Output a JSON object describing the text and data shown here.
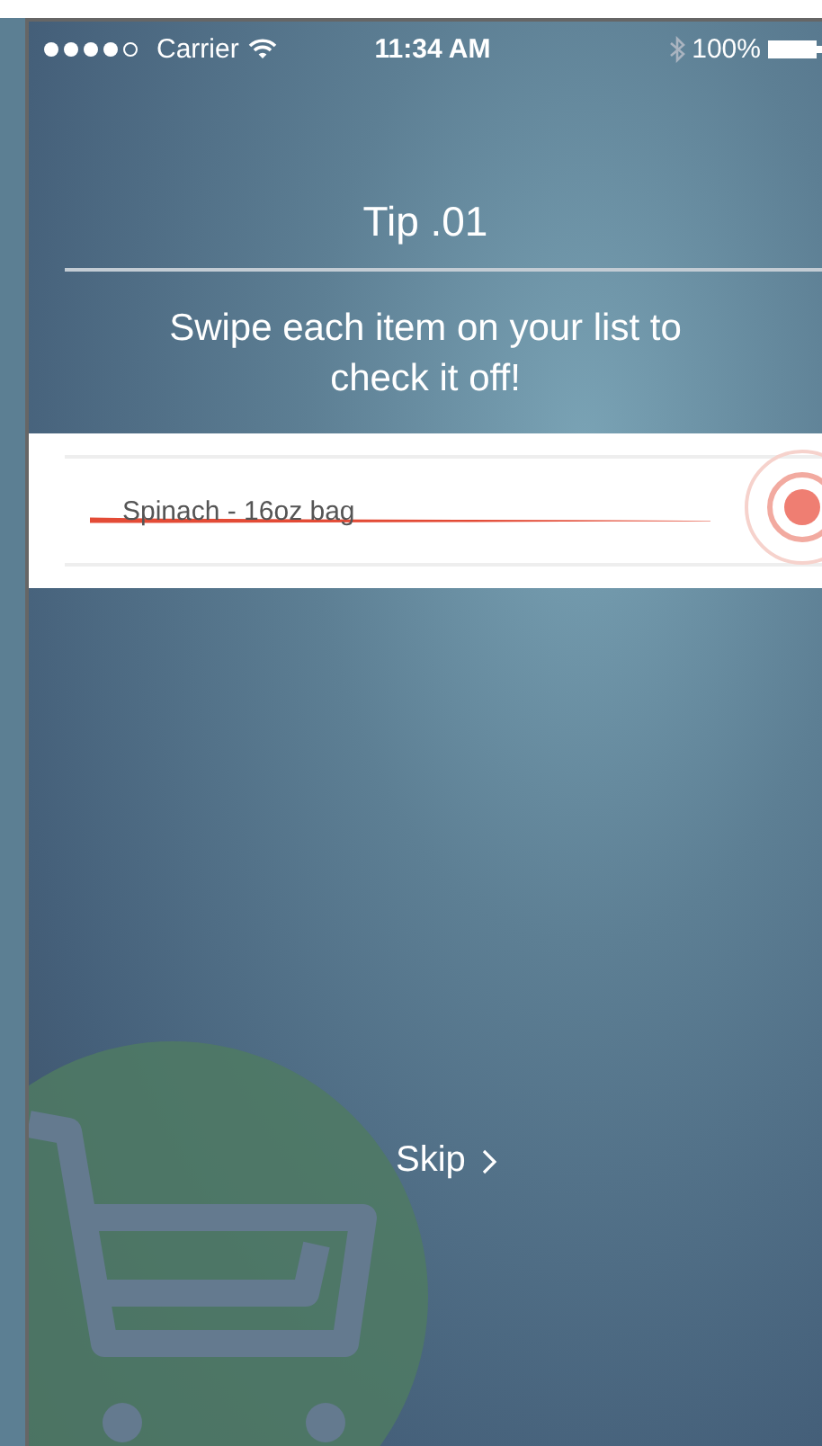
{
  "status_bar": {
    "carrier": "Carrier",
    "time": "11:34 AM",
    "battery": "100%"
  },
  "tip": {
    "title": "Tip .01",
    "message": "Swipe each item on your list to check it off!"
  },
  "list_item": {
    "text": "Spinach - 16oz bag",
    "checked": true
  },
  "skip_button": {
    "label": "Skip"
  }
}
